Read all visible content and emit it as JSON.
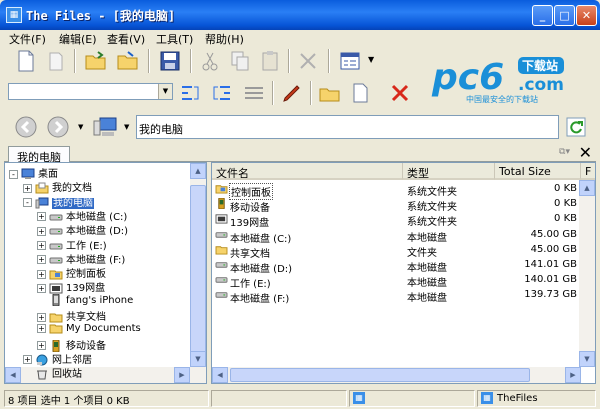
{
  "window": {
    "title": "The Files - [我的电脑]",
    "app_icon": "files-app-icon"
  },
  "menu": [
    "文件(F)",
    "编辑(E)",
    "查看(V)",
    "工具(T)",
    "帮助(H)"
  ],
  "address": {
    "value": "我的电脑"
  },
  "tab": {
    "label": "我的电脑"
  },
  "logo": {
    "brand": "pc6",
    "suffix": ".com",
    "badge": "下载站",
    "tagline": "中国最安全的下载站"
  },
  "tree": {
    "items": [
      {
        "label": "桌面",
        "level": 0,
        "expander": "-",
        "icon": "desktop-icon"
      },
      {
        "label": "我的文档",
        "level": 1,
        "expander": "+",
        "icon": "documents-folder-icon"
      },
      {
        "label": "我的电脑",
        "level": 1,
        "expander": "-",
        "icon": "computer-icon",
        "selected": true
      },
      {
        "label": "本地磁盘 (C:)",
        "level": 2,
        "expander": "+",
        "icon": "drive-icon"
      },
      {
        "label": "本地磁盘 (D:)",
        "level": 2,
        "expander": "+",
        "icon": "drive-icon"
      },
      {
        "label": "工作 (E:)",
        "level": 2,
        "expander": "+",
        "icon": "drive-icon"
      },
      {
        "label": "本地磁盘 (F:)",
        "level": 2,
        "expander": "+",
        "icon": "drive-icon"
      },
      {
        "label": "控制面板",
        "level": 2,
        "expander": "+",
        "icon": "control-panel-icon"
      },
      {
        "label": "139网盘",
        "level": 2,
        "expander": "+",
        "icon": "netdisk-icon"
      },
      {
        "label": "fang's iPhone",
        "level": 2,
        "expander": "",
        "icon": "iphone-icon"
      },
      {
        "label": "共享文档",
        "level": 2,
        "expander": "+",
        "icon": "folder-icon"
      },
      {
        "label": "My Documents",
        "level": 2,
        "expander": "+",
        "icon": "folder-icon"
      },
      {
        "label": "移动设备",
        "level": 2,
        "expander": "+",
        "icon": "mobile-device-icon"
      },
      {
        "label": "网上邻居",
        "level": 1,
        "expander": "+",
        "icon": "network-icon"
      },
      {
        "label": "回收站",
        "level": 1,
        "expander": "",
        "icon": "recycle-bin-icon"
      }
    ]
  },
  "list": {
    "columns": [
      "文件名",
      "类型",
      "Total Size",
      "F"
    ],
    "rows": [
      {
        "name": "控制面板",
        "type": "系统文件夹",
        "size": "0 KB",
        "icon": "control-panel-icon"
      },
      {
        "name": "移动设备",
        "type": "系统文件夹",
        "size": "0 KB",
        "icon": "mobile-device-icon"
      },
      {
        "name": "139网盘",
        "type": "系统文件夹",
        "size": "0 KB",
        "icon": "netdisk-icon"
      },
      {
        "name": "本地磁盘 (C:)",
        "type": "本地磁盘",
        "size": "45.00 GB",
        "icon": "drive-icon"
      },
      {
        "name": "共享文档",
        "type": "文件夹",
        "size": "45.00 GB",
        "icon": "folder-icon"
      },
      {
        "name": "本地磁盘 (D:)",
        "type": "本地磁盘",
        "size": "141.01 GB",
        "icon": "drive-icon"
      },
      {
        "name": "工作 (E:)",
        "type": "本地磁盘",
        "size": "140.01 GB",
        "icon": "drive-icon"
      },
      {
        "name": "本地磁盘 (F:)",
        "type": "本地磁盘",
        "size": "139.73 GB",
        "icon": "drive-icon"
      }
    ]
  },
  "status": {
    "summary": "8 项目 选中 1 个项目 0 KB",
    "app": "TheFiles"
  },
  "colors": {
    "title_bar": "#0a5ddd",
    "selection": "#316ac5",
    "folder": "#f6d36b",
    "logo_blue": "#1a8fd8"
  }
}
